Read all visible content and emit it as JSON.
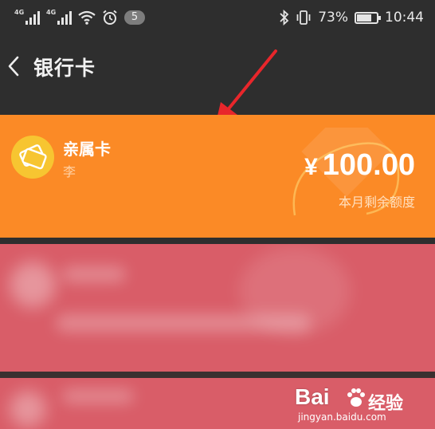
{
  "status_bar": {
    "signal_1_tag": "4G",
    "signal_2_tag": "4G",
    "notification_count": "5",
    "battery_percent": "73%",
    "battery_level": 0.73,
    "time": "10:44"
  },
  "header": {
    "title": "银行卡"
  },
  "cards": [
    {
      "name": "亲属卡",
      "holder": "李",
      "currency": "¥",
      "amount": "100.00",
      "amount_label": "本月剩余额度",
      "color": "#fb8a26",
      "icon_color": "#f7c531"
    },
    {
      "color": "#d95d68"
    },
    {
      "color": "#d95d68"
    }
  ],
  "annotation": {
    "arrow_color": "#e8262b"
  },
  "watermark": {
    "logo": "Bai",
    "cn": "经验",
    "url": "jingyan.baidu.com"
  }
}
